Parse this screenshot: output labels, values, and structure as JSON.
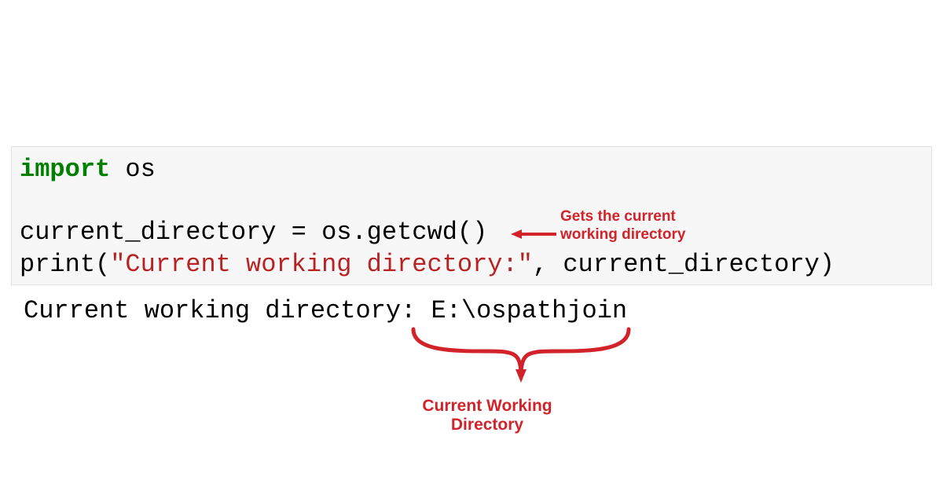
{
  "code": {
    "line1_keyword": "import",
    "line1_module": " os",
    "line3_text": "current_directory = os.getcwd()",
    "line4_func": "print",
    "line4_paren_open": "(",
    "line4_string": "\"Current working directory:\"",
    "line4_rest": ", current_directory)"
  },
  "output": {
    "label": "Current working directory: ",
    "path": "E:\\ospathjoin"
  },
  "annotations": {
    "arrow_label": "Gets the current\nworking directory",
    "brace_label": "Current Working\nDirectory"
  },
  "colors": {
    "annotation": "#d2232a",
    "keyword": "#008000",
    "string": "#BA2121",
    "code_bg": "#f7f7f7"
  }
}
